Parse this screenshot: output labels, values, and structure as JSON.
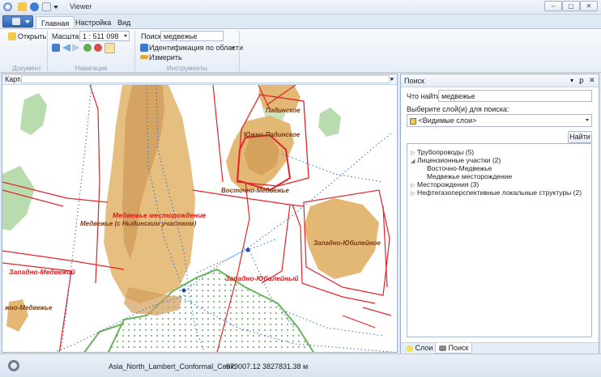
{
  "window": {
    "title": "Viewer"
  },
  "ribbon": {
    "tabs": [
      {
        "label": "Главная"
      },
      {
        "label": "Настройка"
      },
      {
        "label": "Вид"
      }
    ],
    "document": {
      "open_label": "Открыть",
      "group_label": "Документ"
    },
    "navigation": {
      "scale_label": "Масштаб",
      "scale_value": "1 : 511 098",
      "group_label": "Навигация"
    },
    "tools": {
      "search_label": "Поиск",
      "search_value": "медвежье",
      "identify_label": "Идентификация по области",
      "measure_label": "Измерить",
      "group_label": "Инструменты"
    }
  },
  "map": {
    "pane_title": "Карта",
    "labels": {
      "padinskoe": "Падинское",
      "yuzhno_padinskoe": "Южно-Падинское",
      "vostochno_medvezhe": "Восточно-Медвежье",
      "medvezhe_field": "Медвежье месторождение",
      "medvezhe_nydinsky": "Медвежье (с Ныдинским участком)",
      "zapadno_yubileinoe": "Западно-Юбилейное",
      "zapadno_medvezhiy": "Западно-Медвежий",
      "zapadno_yubileiny": "Западно-Юбилейный",
      "yuzhno_medvezhe_partial": "жно-Медвежье"
    }
  },
  "search_panel": {
    "title": "Поиск",
    "find_label": "Что найти:",
    "find_value": "медвежье",
    "layers_label": "Выберите слой(и) для поиска:",
    "layers_value": "<Видимые слои>",
    "find_button": "Найти",
    "results": [
      {
        "label": "Трубопроводы (5)",
        "expanded": false
      },
      {
        "label": "Лицензионные участки (2)",
        "expanded": true,
        "children": [
          "Восточно-Медвежье",
          "Медвежье месторождение"
        ]
      },
      {
        "label": "Месторождения (3)",
        "expanded": false
      },
      {
        "label": "Нефтегазоперспективные локальные структуры (2)",
        "expanded": false
      }
    ],
    "bottom_tabs": [
      {
        "label": "Слои"
      },
      {
        "label": "Поиск"
      }
    ]
  },
  "statusbar": {
    "projection": "Asia_North_Lambert_Conformal_Conic",
    "x": "-979007.12",
    "y": "3827831.38 м"
  },
  "colors": {
    "field_fill": "#e3b875",
    "field_dark": "#d29e5a",
    "green_area": "#b9dcae",
    "license_border": "#e2242a",
    "pipeline": "#2d6fd8",
    "label_red": "#e0161a",
    "label_brown": "#7a3a12"
  }
}
